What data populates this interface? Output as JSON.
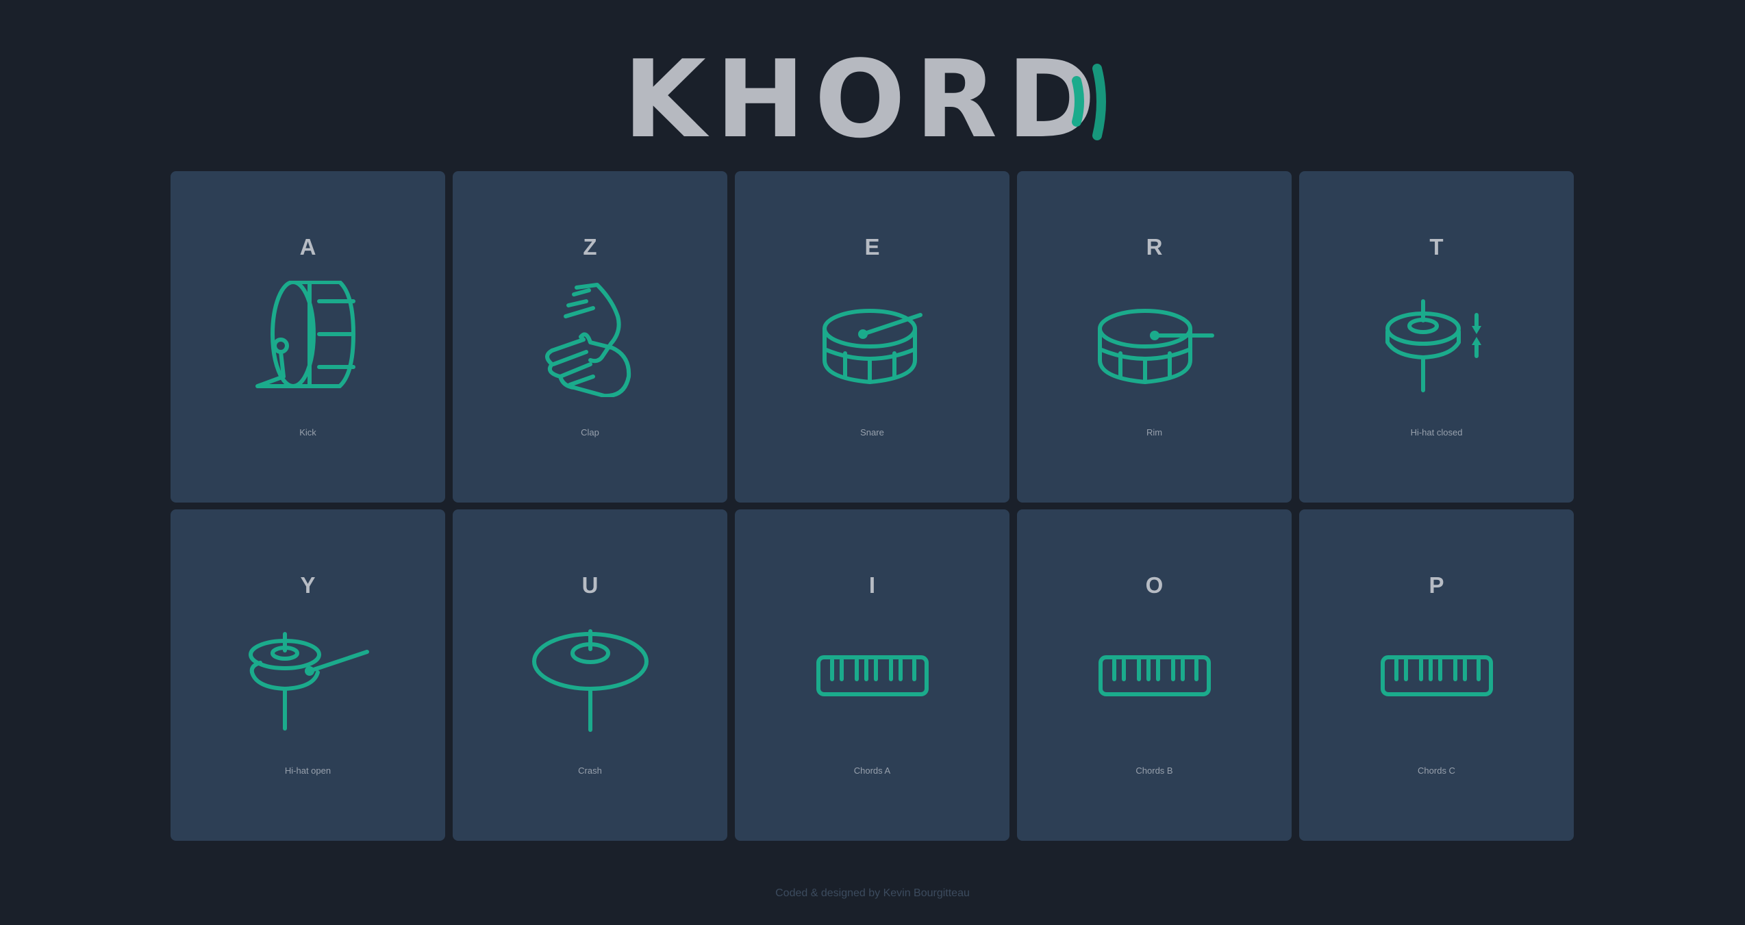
{
  "app": {
    "logo_text": "KHORD",
    "accent_color": "#1bab8c",
    "background_color": "#1a202a",
    "pad_color": "#2d3f55"
  },
  "pads": [
    {
      "key": "A",
      "label": "Kick",
      "icon": "kick-drum-icon"
    },
    {
      "key": "Z",
      "label": "Clap",
      "icon": "clap-icon"
    },
    {
      "key": "E",
      "label": "Snare",
      "icon": "snare-drum-icon"
    },
    {
      "key": "R",
      "label": "Rim",
      "icon": "rim-icon"
    },
    {
      "key": "T",
      "label": "Hi-hat closed",
      "icon": "hihat-closed-icon"
    },
    {
      "key": "Y",
      "label": "Hi-hat open",
      "icon": "hihat-open-icon"
    },
    {
      "key": "U",
      "label": "Crash",
      "icon": "crash-cymbal-icon"
    },
    {
      "key": "I",
      "label": "Chords A",
      "icon": "keyboard-icon"
    },
    {
      "key": "O",
      "label": "Chords B",
      "icon": "keyboard-icon"
    },
    {
      "key": "P",
      "label": "Chords C",
      "icon": "keyboard-icon"
    }
  ],
  "footer": {
    "text": "Coded & designed by Kevin Bourgitteau"
  }
}
